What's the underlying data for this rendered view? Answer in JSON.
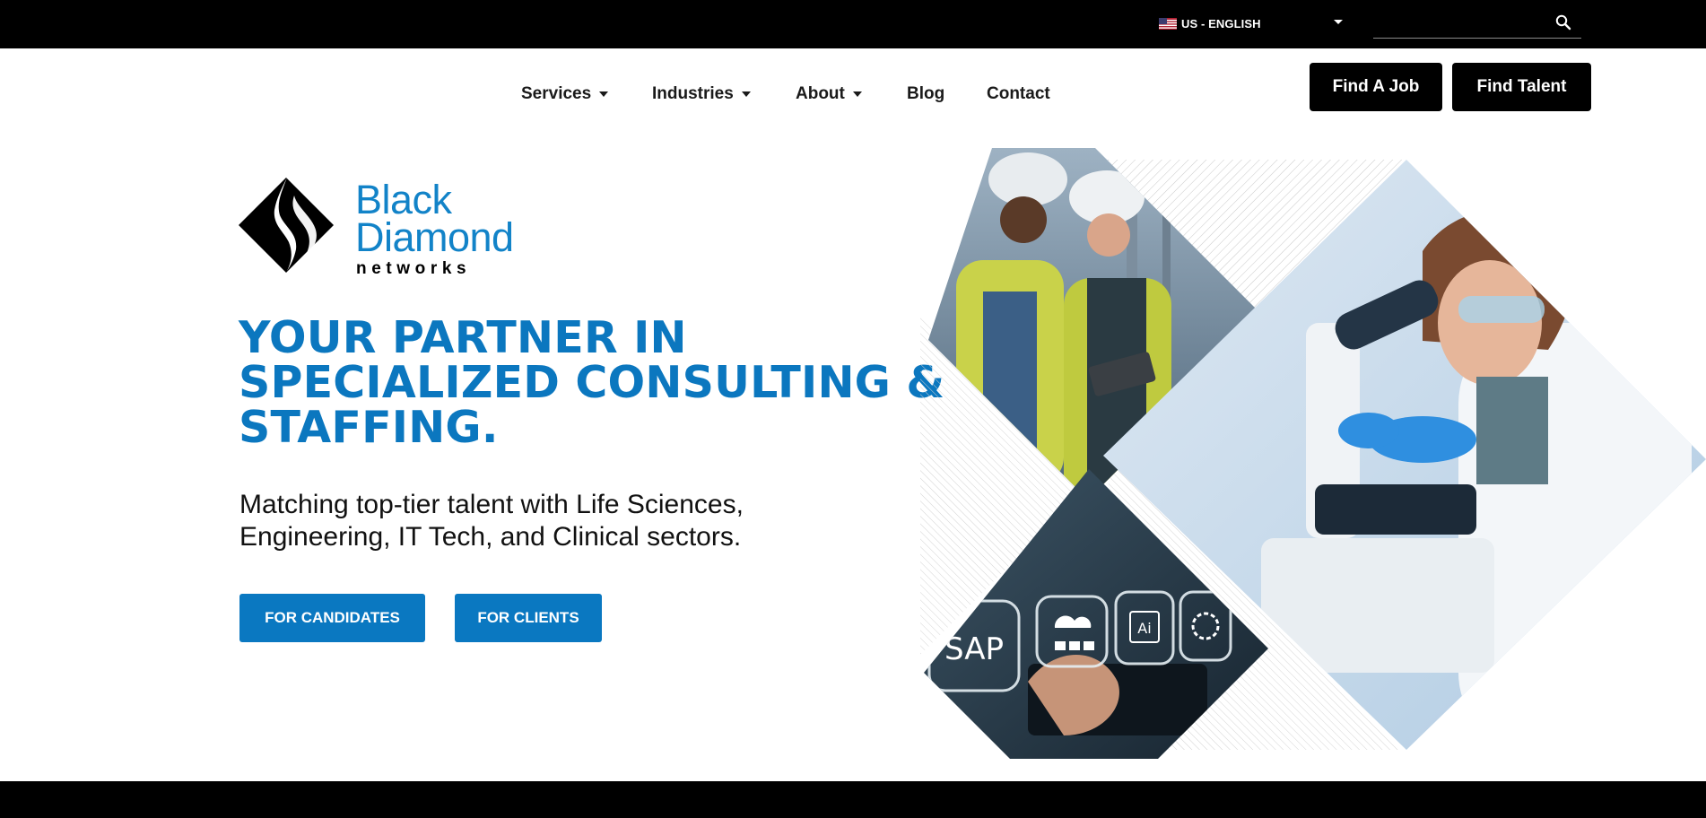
{
  "topbar": {
    "language_label": "US - ENGLISH",
    "search_placeholder": "",
    "colors": {
      "background": "#000000",
      "text": "#ffffff"
    },
    "icons": [
      "us-flag-icon",
      "caret-down-icon",
      "search-icon"
    ]
  },
  "nav": {
    "items": [
      {
        "label": "Services",
        "has_dropdown": true
      },
      {
        "label": "Industries",
        "has_dropdown": true
      },
      {
        "label": "About",
        "has_dropdown": true
      },
      {
        "label": "Blog",
        "has_dropdown": false
      },
      {
        "label": "Contact",
        "has_dropdown": false
      }
    ],
    "cta": [
      "Find A Job",
      "Find Talent"
    ]
  },
  "logo": {
    "line1": "Black",
    "line2": "Diamond",
    "line3": "networks",
    "color": "#1283c8"
  },
  "hero": {
    "headline_lines": [
      "YOUR PARTNER IN",
      "SPECIALIZED CONSULTING &",
      "STAFFING."
    ],
    "subtext_lines": [
      "Matching top-tier talent with Life Sciences,",
      "Engineering, IT Tech, and Clinical sectors."
    ],
    "buttons": [
      "FOR CANDIDATES",
      "FOR CLIENTS"
    ],
    "accent_color": "#0b77bf"
  },
  "collage": {
    "tiles": [
      "engineers-photo",
      "scientist-microscope-photo",
      "sap-tech-icons-photo"
    ],
    "tech_icon_labels": [
      "SAP",
      "Ai"
    ]
  }
}
